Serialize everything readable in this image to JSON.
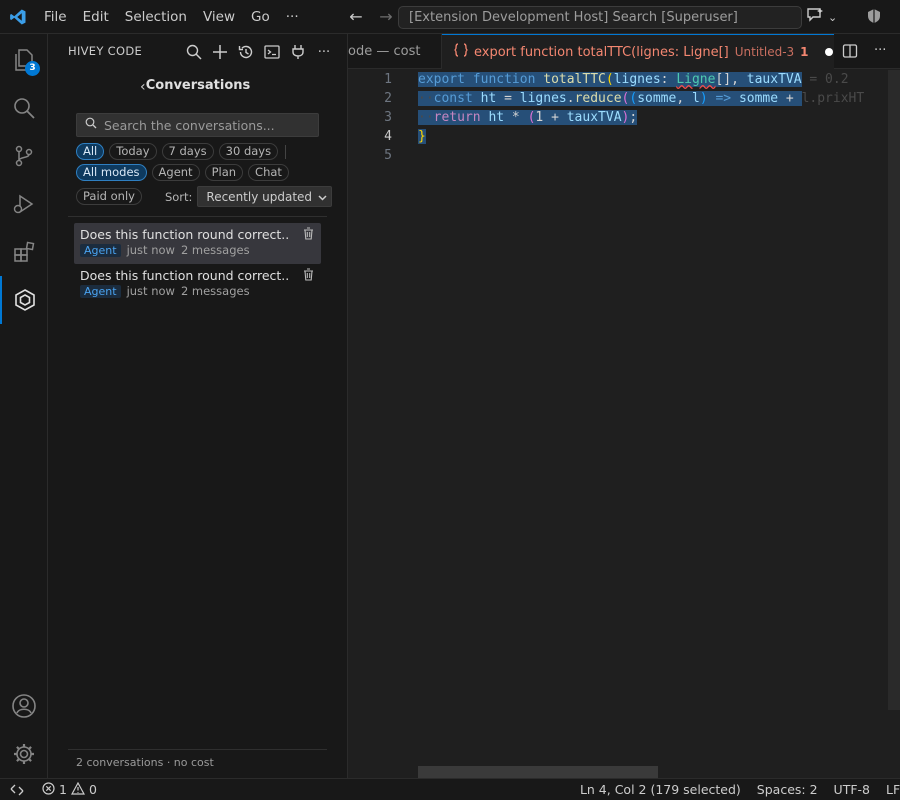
{
  "menu": {
    "items": [
      "File",
      "Edit",
      "Selection",
      "View",
      "Go"
    ],
    "more": "···"
  },
  "command_center": "[Extension Development Host] Search [Superuser]",
  "activity": {
    "explorer_badge": "3"
  },
  "sidebar": {
    "header": "HIVEY CODE",
    "title": "Conversations",
    "search_placeholder": "Search the conversations...",
    "time_filters": [
      {
        "label": "All",
        "selected": true
      },
      {
        "label": "Today",
        "selected": false
      },
      {
        "label": "7 days",
        "selected": false
      },
      {
        "label": "30 days",
        "selected": false
      }
    ],
    "mode_filters": [
      {
        "label": "All modes",
        "selected": true
      },
      {
        "label": "Agent",
        "selected": false
      },
      {
        "label": "Plan",
        "selected": false
      },
      {
        "label": "Chat",
        "selected": false
      }
    ],
    "paid_only": "Paid only",
    "sort_label": "Sort:",
    "sort_value": "Recently updated",
    "conversations": [
      {
        "title": "Does this function round correct...",
        "mode": "Agent",
        "time": "just now",
        "messages": "2 messages"
      },
      {
        "title": "Does this function round correct...",
        "mode": "Agent",
        "time": "just now",
        "messages": "2 messages"
      }
    ],
    "footer": "2 conversations · no cost"
  },
  "editor": {
    "inactive_tab": "ode — cost",
    "active_tab": {
      "title": "export function totalTTC(lignes: Ligne[]",
      "untitled": "Untitled-3",
      "errors": "1"
    },
    "line_numbers": [
      "1",
      "2",
      "3",
      "4",
      "5"
    ],
    "current_line": "4"
  },
  "status": {
    "errors": "1",
    "warnings": "0",
    "position": "Ln 4, Col 2 (179 selected)",
    "spaces": "Spaces: 2",
    "encoding": "UTF-8",
    "eol": "LF"
  },
  "colors": {
    "accent": "#0078d4",
    "error": "#f48771",
    "selection": "#264f78"
  }
}
